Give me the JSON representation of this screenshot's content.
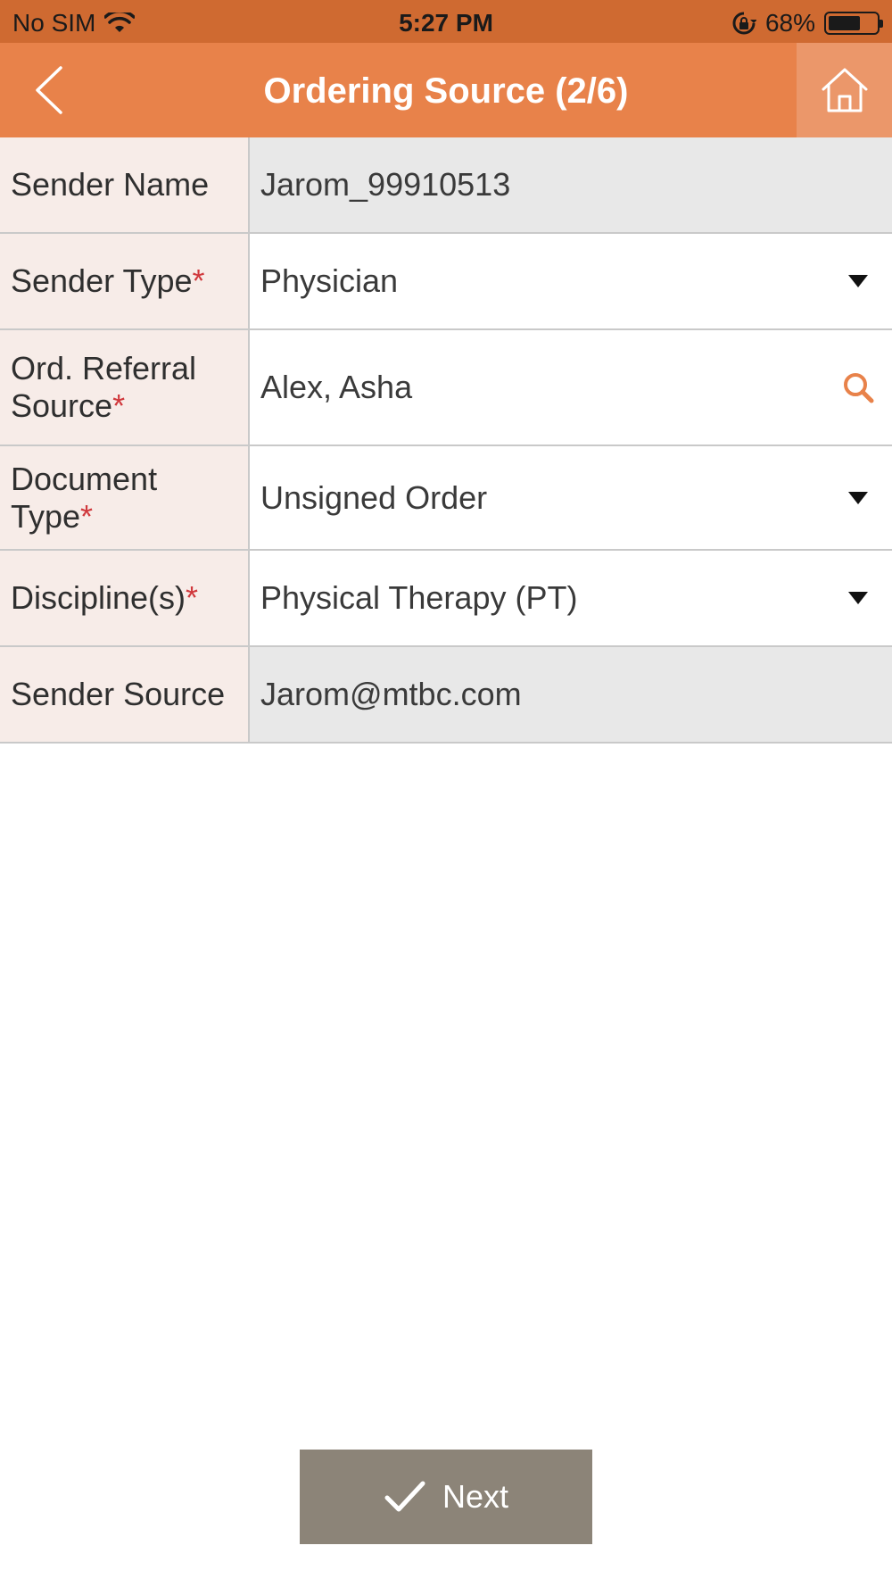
{
  "status_bar": {
    "carrier": "No SIM",
    "time": "5:27 PM",
    "battery_percent": "68%",
    "battery_level": 0.68
  },
  "nav": {
    "title": "Ordering Source (2/6)",
    "back_icon": "chevron-left-icon",
    "home_icon": "home-icon",
    "bar_color": "#e8824a",
    "accent_color": "#e8824a"
  },
  "form": {
    "required_marker": "*",
    "fields": [
      {
        "label": "Sender Name",
        "required": false,
        "value": "Jarom_99910513",
        "control": "readonly"
      },
      {
        "label": "Sender Type",
        "required": true,
        "value": "Physician",
        "control": "dropdown"
      },
      {
        "label": "Ord. Referral Source",
        "required": true,
        "value": "Alex, Asha",
        "control": "search"
      },
      {
        "label": "Document Type",
        "required": true,
        "value": "Unsigned Order",
        "control": "dropdown"
      },
      {
        "label": "Discipline(s)",
        "required": true,
        "value": "Physical Therapy (PT)",
        "control": "dropdown"
      },
      {
        "label": "Sender Source",
        "required": false,
        "value": "Jarom@mtbc.com",
        "control": "readonly"
      }
    ]
  },
  "footer": {
    "next_label": "Next",
    "next_icon": "checkmark-icon",
    "button_color": "#8c8478"
  }
}
